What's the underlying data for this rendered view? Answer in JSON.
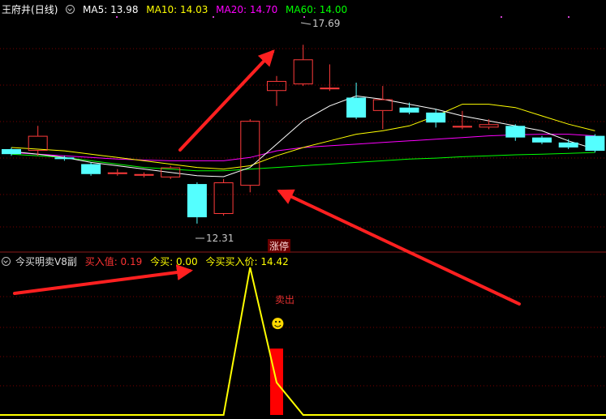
{
  "header_top": {
    "stock_name": "王府井",
    "period": "(日线)",
    "ma_items": [
      {
        "label": "MA5: 13.98",
        "color": "#ffffff"
      },
      {
        "label": "MA10: 14.03",
        "color": "#ffff00"
      },
      {
        "label": "MA20: 14.70",
        "color": "#ff00ff"
      },
      {
        "label": "MA60: 14.00",
        "color": "#00ff00"
      }
    ]
  },
  "header_bottom": {
    "indicator_name": "今买明卖V8副",
    "items": [
      {
        "label": "买入值: 0.19",
        "color": "#ff3333"
      },
      {
        "label": "今买: 0.00",
        "color": "#ffff00"
      },
      {
        "label": "今买买入价: 14.42",
        "color": "#ffff00"
      }
    ]
  },
  "annotations": {
    "limit_up": "涨停",
    "sell": "卖出",
    "smiley": "☻",
    "high_label": "17.69",
    "low_label": "12.31"
  },
  "colors": {
    "up": "#ff3b3b",
    "down": "#54ffff",
    "ma5": "#ffffff",
    "ma10": "#ffff00",
    "ma20": "#ff00ff",
    "ma60": "#00ff00",
    "indicator_line": "#ffff00",
    "signal_bar": "#ff0000",
    "arrow": "#ff2020"
  },
  "chart_data": [
    {
      "type": "candlestick",
      "title": "王府井 (日线)",
      "ylim": [
        11.6,
        18.5
      ],
      "candles": [
        {
          "o": 14.55,
          "c": 14.4,
          "h": 14.6,
          "l": 14.35
        },
        {
          "o": 14.5,
          "c": 14.95,
          "h": 15.25,
          "l": 14.35
        },
        {
          "o": 14.3,
          "c": 14.25,
          "h": 14.35,
          "l": 14.2
        },
        {
          "o": 14.1,
          "c": 13.8,
          "h": 14.15,
          "l": 13.75
        },
        {
          "o": 13.8,
          "c": 13.85,
          "h": 13.95,
          "l": 13.75
        },
        {
          "o": 13.75,
          "c": 13.8,
          "h": 13.85,
          "l": 13.7
        },
        {
          "o": 13.7,
          "c": 14.0,
          "h": 14.05,
          "l": 13.65
        },
        {
          "o": 13.5,
          "c": 12.5,
          "h": 13.55,
          "l": 12.31
        },
        {
          "o": 12.6,
          "c": 13.55,
          "h": 13.65,
          "l": 12.55
        },
        {
          "o": 13.45,
          "c": 15.4,
          "h": 15.45,
          "l": 13.25
        },
        {
          "o": 16.3,
          "c": 16.6,
          "h": 16.75,
          "l": 15.85
        },
        {
          "o": 16.5,
          "c": 17.25,
          "h": 17.69,
          "l": 16.45
        },
        {
          "o": 16.35,
          "c": 16.4,
          "h": 17.1,
          "l": 16.3
        },
        {
          "o": 16.1,
          "c": 15.5,
          "h": 16.55,
          "l": 15.45
        },
        {
          "o": 15.7,
          "c": 16.05,
          "h": 16.45,
          "l": 15.15
        },
        {
          "o": 15.8,
          "c": 15.65,
          "h": 15.95,
          "l": 15.6
        },
        {
          "o": 15.65,
          "c": 15.35,
          "h": 15.75,
          "l": 15.2
        },
        {
          "o": 15.2,
          "c": 15.25,
          "h": 15.7,
          "l": 15.15
        },
        {
          "o": 15.2,
          "c": 15.3,
          "h": 15.45,
          "l": 15.15
        },
        {
          "o": 15.25,
          "c": 14.9,
          "h": 15.3,
          "l": 14.8
        },
        {
          "o": 14.9,
          "c": 14.75,
          "h": 14.95,
          "l": 14.7
        },
        {
          "o": 14.75,
          "c": 14.6,
          "h": 14.85,
          "l": 14.55
        },
        {
          "o": 14.95,
          "c": 14.5,
          "h": 15.0,
          "l": 14.45
        }
      ],
      "ma5": [
        14.48,
        14.4,
        14.3,
        14.15,
        14.05,
        13.95,
        13.85,
        13.75,
        13.72,
        14.0,
        14.7,
        15.4,
        15.85,
        16.15,
        16.05,
        15.9,
        15.75,
        15.55,
        15.4,
        15.25,
        15.1,
        14.8,
        14.55
      ],
      "ma10": [
        14.6,
        14.55,
        14.5,
        14.4,
        14.3,
        14.2,
        14.1,
        14.0,
        13.95,
        14.05,
        14.35,
        14.6,
        14.8,
        15.0,
        15.1,
        15.25,
        15.55,
        15.9,
        15.9,
        15.8,
        15.55,
        15.3,
        15.1
      ],
      "ma20": [
        14.45,
        14.4,
        14.35,
        14.3,
        14.25,
        14.22,
        14.2,
        14.2,
        14.2,
        14.3,
        14.5,
        14.6,
        14.65,
        14.7,
        14.75,
        14.8,
        14.85,
        14.9,
        14.95,
        14.98,
        15.0,
        15.0,
        14.95
      ],
      "ma60": [
        14.4,
        14.35,
        14.3,
        14.2,
        14.1,
        14.0,
        13.95,
        13.9,
        13.9,
        13.95,
        14.0,
        14.05,
        14.1,
        14.15,
        14.2,
        14.25,
        14.28,
        14.32,
        14.35,
        14.38,
        14.4,
        14.42,
        14.45
      ]
    },
    {
      "type": "line",
      "title": "今买明卖V8副",
      "ylim": [
        0,
        1
      ],
      "line": [
        0,
        0,
        0,
        0,
        0,
        0,
        0,
        0,
        0,
        1,
        0.22,
        0,
        0,
        0,
        0,
        0,
        0,
        0,
        0,
        0,
        0,
        0,
        0
      ],
      "bars": [
        {
          "index": 10,
          "value": 0.45
        }
      ]
    }
  ]
}
